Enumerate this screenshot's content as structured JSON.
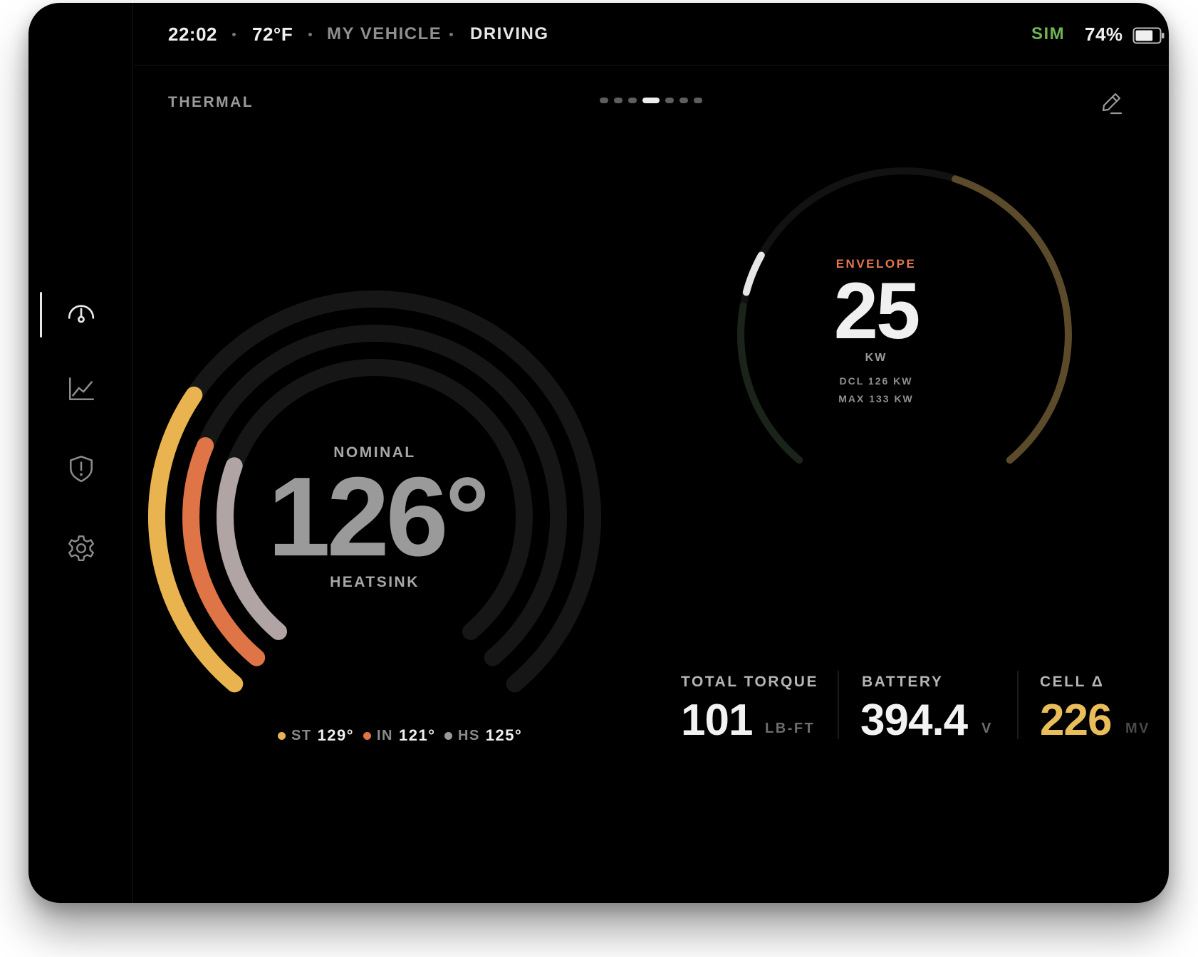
{
  "status_bar": {
    "time": "22:02",
    "temperature": "72°F",
    "vehicle_name": "MY VEHICLE",
    "mode": "DRIVING",
    "sim_label": "SIM",
    "battery_percent": "74%",
    "battery_level": 0.74
  },
  "sidebar": {
    "items": [
      {
        "name": "dashboard",
        "icon": "gauge-icon",
        "active": true
      },
      {
        "name": "charts",
        "icon": "line-chart-icon",
        "active": false
      },
      {
        "name": "alerts",
        "icon": "shield-alert-icon",
        "active": false
      },
      {
        "name": "settings",
        "icon": "gear-icon",
        "active": false
      }
    ]
  },
  "page": {
    "title": "THERMAL",
    "page_count": 7,
    "active_page": 3
  },
  "thermal_gauge": {
    "status": "NOMINAL",
    "value": "126°",
    "label": "HEATSINK",
    "rings": [
      {
        "key": "ST",
        "color": "#e9b44f",
        "level": 0.3
      },
      {
        "key": "IN",
        "color": "#df7446",
        "level": 0.26
      },
      {
        "key": "HS",
        "color": "#b0a4a4",
        "level": 0.25
      }
    ],
    "legend": [
      {
        "key": "ST",
        "value": "129°",
        "color": "#e9b44f"
      },
      {
        "key": "IN",
        "value": "121°",
        "color": "#df7446"
      },
      {
        "key": "HS",
        "value": "125°",
        "color": "#9a9a9a"
      }
    ]
  },
  "envelope_gauge": {
    "label": "ENVELOPE",
    "value": "25",
    "unit": "KW",
    "dcl_line": "DCL 126 KW",
    "max_line": "MAX 133 KW",
    "accent_color": "#e0794e",
    "limit_band_color": "#5c4b2b"
  },
  "metrics": [
    {
      "label": "TOTAL TORQUE",
      "value": "101",
      "unit": "LB-FT",
      "color": "#f2f2f2"
    },
    {
      "label": "BATTERY",
      "value": "394.4",
      "unit": "V",
      "color": "#f2f2f2"
    },
    {
      "label": "CELL Δ",
      "value": "226",
      "unit": "MV",
      "color": "#e9bd5a"
    }
  ]
}
